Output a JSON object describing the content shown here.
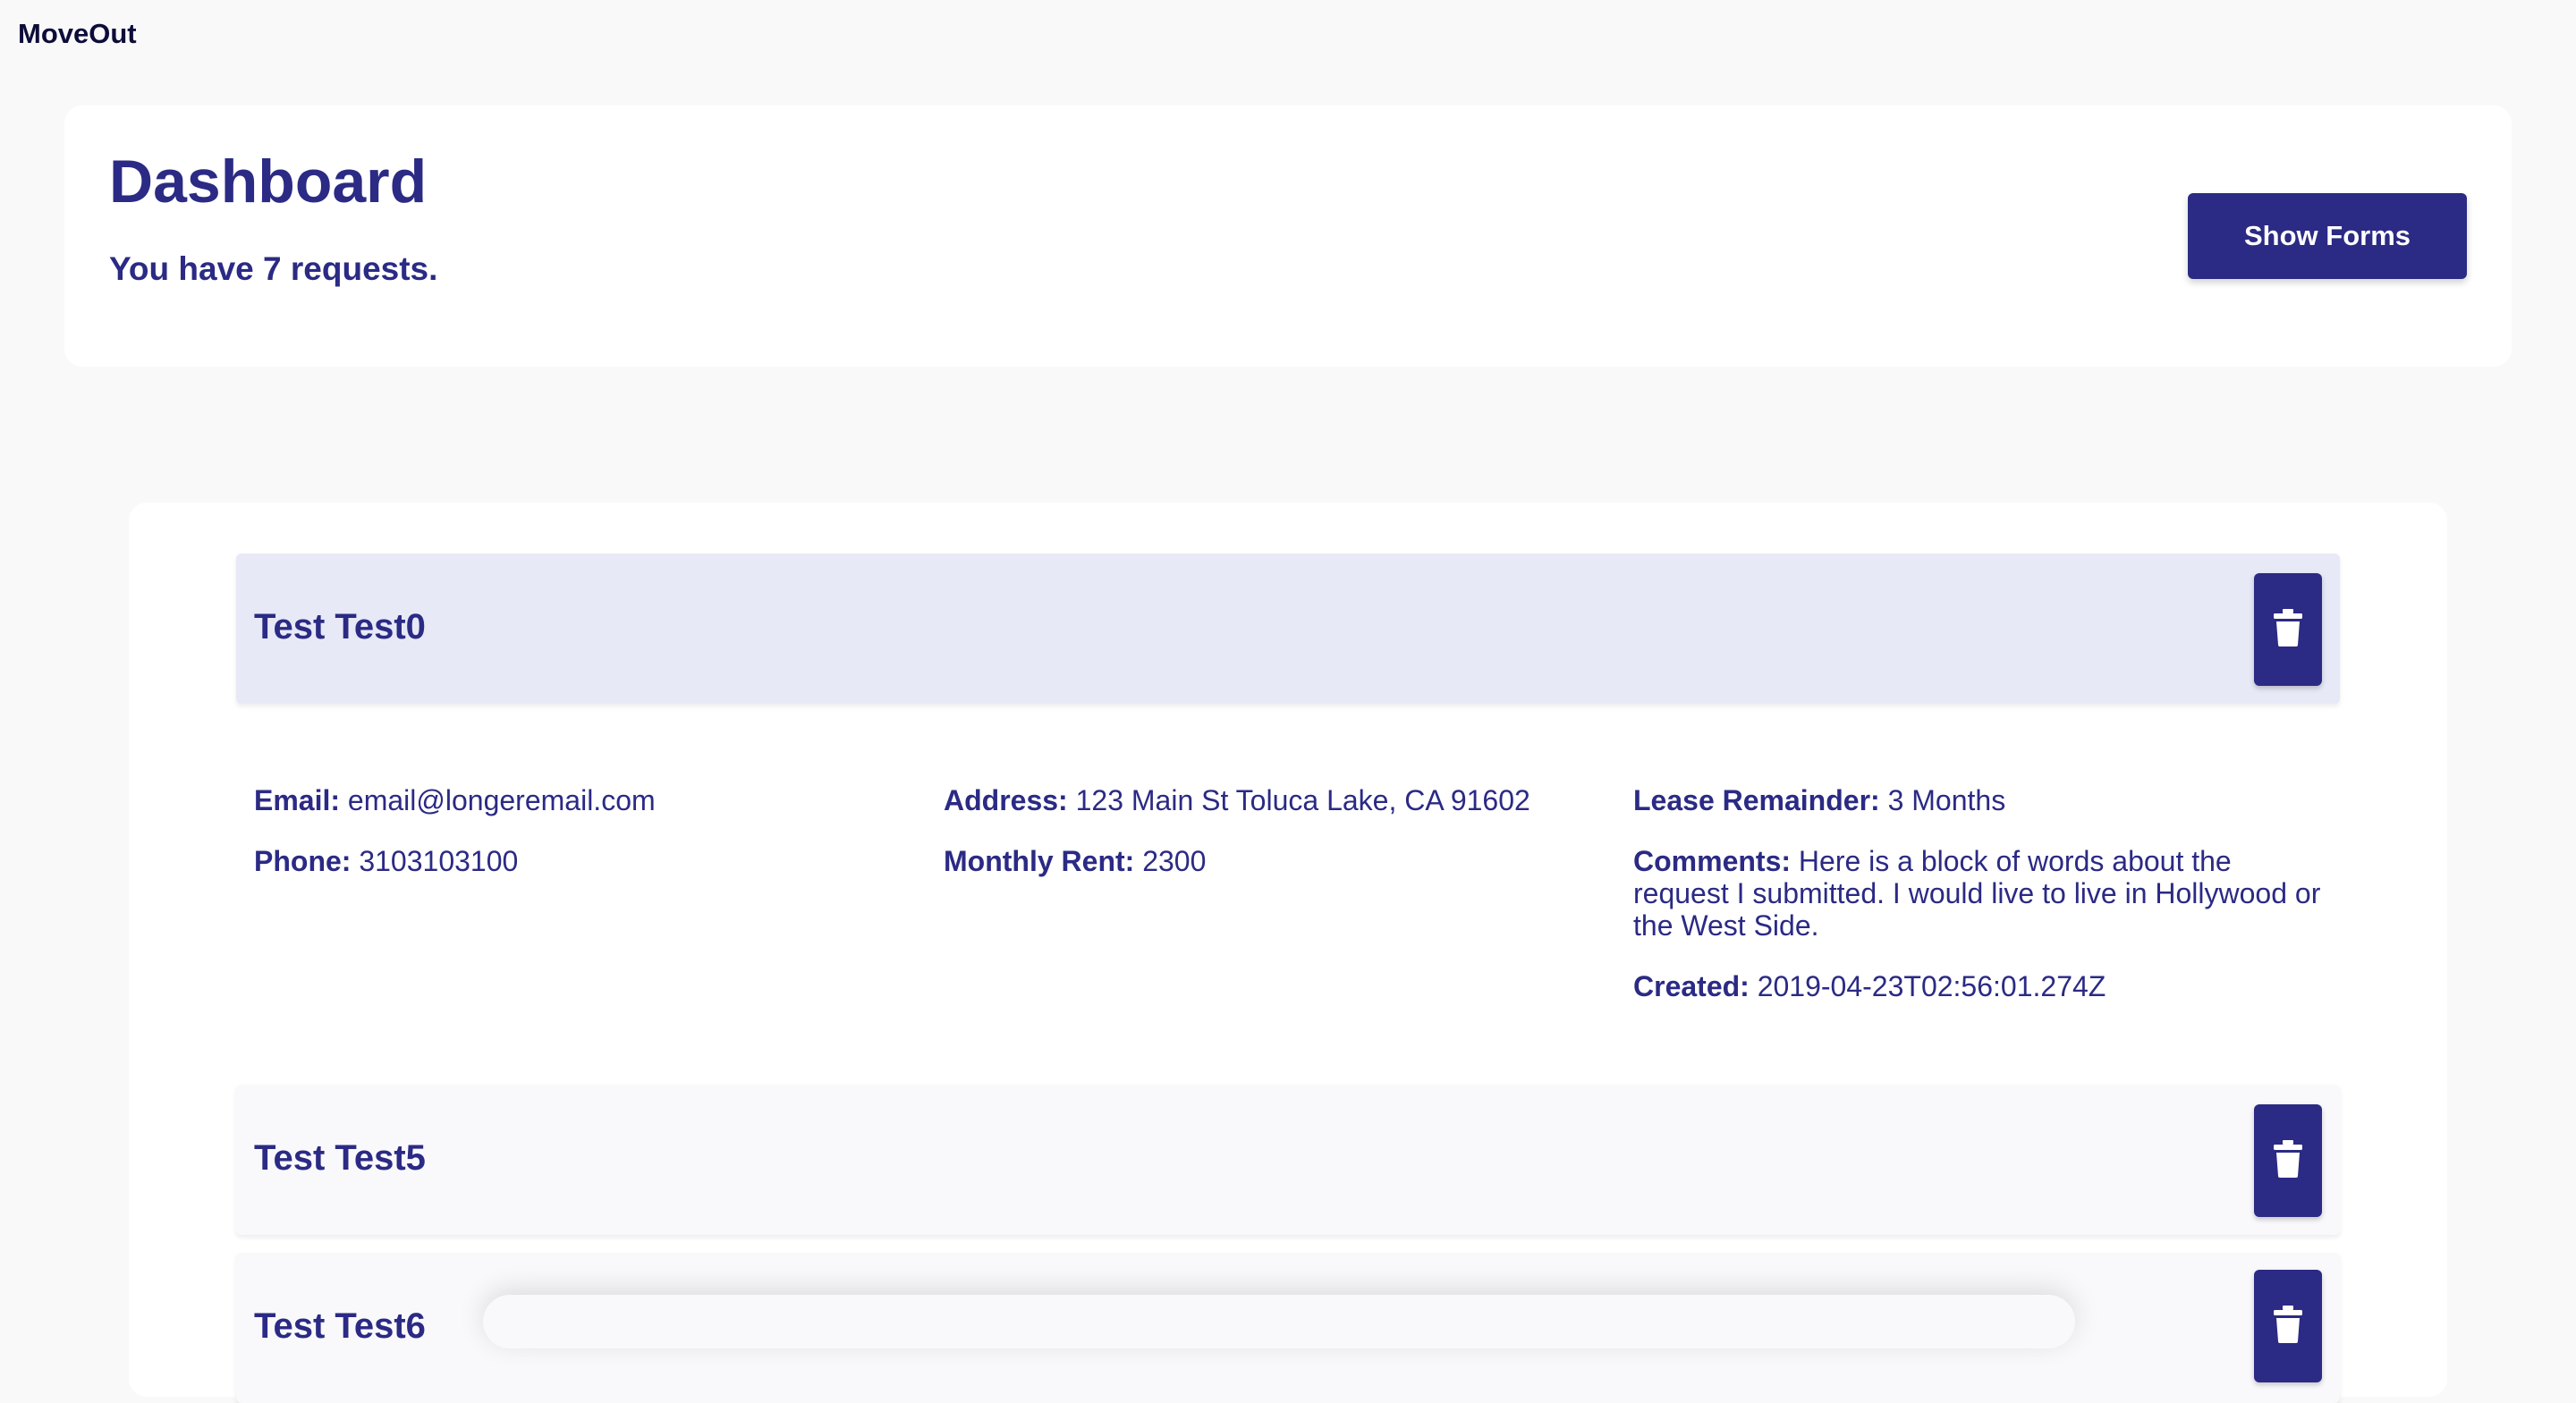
{
  "app": {
    "brand": "MoveOut"
  },
  "dashboard": {
    "title": "Dashboard",
    "subtitle": "You have 7 requests.",
    "show_forms_label": "Show Forms"
  },
  "requests": [
    {
      "name": "Test Test0",
      "expanded": true,
      "email_label": "Email:",
      "email": "email@longeremail.com",
      "phone_label": "Phone:",
      "phone": "3103103100",
      "address_label": "Address:",
      "address": "123 Main St Toluca Lake, CA 91602",
      "rent_label": "Monthly Rent:",
      "rent": "2300",
      "lease_label": "Lease Remainder:",
      "lease": "3 Months",
      "comments_label": "Comments:",
      "comments": "Here is a block of words about the request I submitted. I would live to live in Hollywood or the West Side.",
      "created_label": "Created:",
      "created": "2019-04-23T02:56:01.274Z"
    },
    {
      "name": "Test Test5",
      "expanded": false
    },
    {
      "name": "Test Test6",
      "expanded": false
    }
  ],
  "icons": {
    "delete": "trash-icon"
  },
  "colors": {
    "accent": "#2b2a84",
    "active_header": "#e7e9f6",
    "background": "#f9f9fa"
  }
}
